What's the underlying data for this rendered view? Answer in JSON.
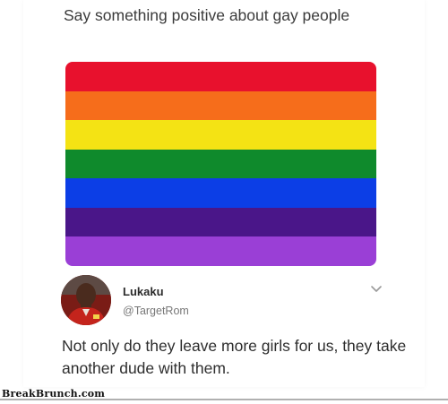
{
  "post": {
    "question": "Say something positive about gay people"
  },
  "flag": {
    "stripes": [
      "#e8112d",
      "#f66d1b",
      "#f4e314",
      "#0f8a2c",
      "#0c3ee6",
      "#4a1689",
      "#9a3fd6"
    ]
  },
  "reply": {
    "author_name": "Lukaku",
    "author_handle": "@TargetRom",
    "text": "Not only do they leave more girls for us, they take another dude with them."
  },
  "watermark": {
    "text": "BreakBrunch.com"
  }
}
